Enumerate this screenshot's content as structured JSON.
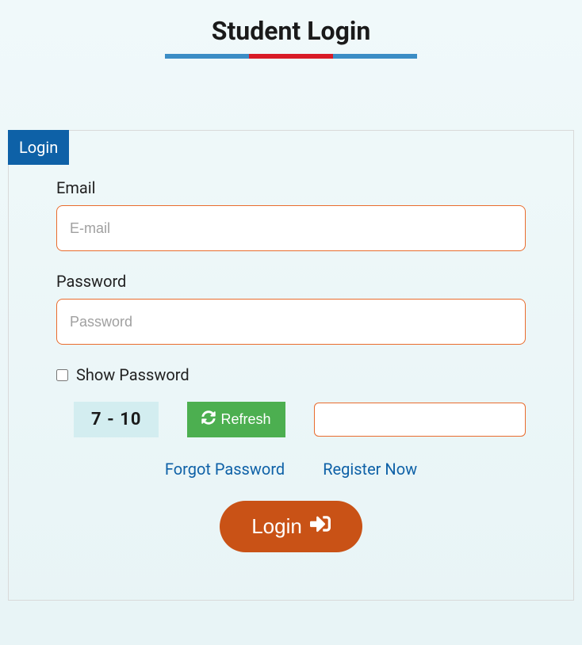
{
  "page": {
    "title": "Student Login"
  },
  "tab": {
    "login_label": "Login"
  },
  "form": {
    "email_label": "Email",
    "email_placeholder": "E-mail",
    "password_label": "Password",
    "password_placeholder": "Password",
    "show_password_label": "Show Password",
    "captcha_text": "7 - 10",
    "refresh_label": "Refresh",
    "forgot_label": "Forgot Password",
    "register_label": "Register Now",
    "login_button_label": "Login"
  }
}
